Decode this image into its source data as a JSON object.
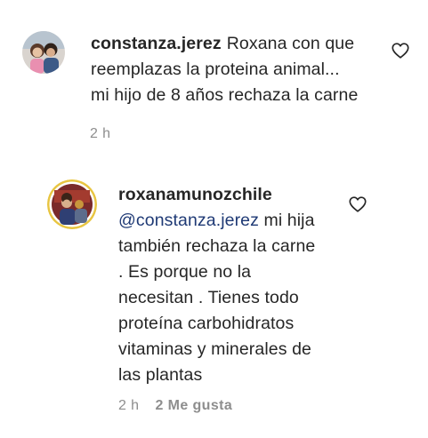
{
  "comment": {
    "username": "constanza.jerez",
    "text_line1": "Roxana con que",
    "text_line2": "reemplazas la proteina animal...",
    "text_line3": "mi hijo de 8 años rechaza la carne",
    "time": "2 h"
  },
  "reply": {
    "username": "roxanamunozchile",
    "mention": "@constanza.jerez",
    "text_line1_rest": " mi hija",
    "text_line2": "también rechaza la carne",
    "text_line3": ". Es porque no la",
    "text_line4": "necesitan . Tienes todo",
    "text_line5": "proteína carbohidratos",
    "text_line6": "vitaminas y minerales de",
    "text_line7": "las plantas",
    "time": "2 h",
    "likes": "2 Me gusta"
  },
  "colors": {
    "text": "#262626",
    "meta": "#8e8e8e",
    "mention": "#1f3a75"
  },
  "icons": {
    "comment_like": "heart-outline-icon",
    "reply_like": "heart-outline-icon"
  }
}
